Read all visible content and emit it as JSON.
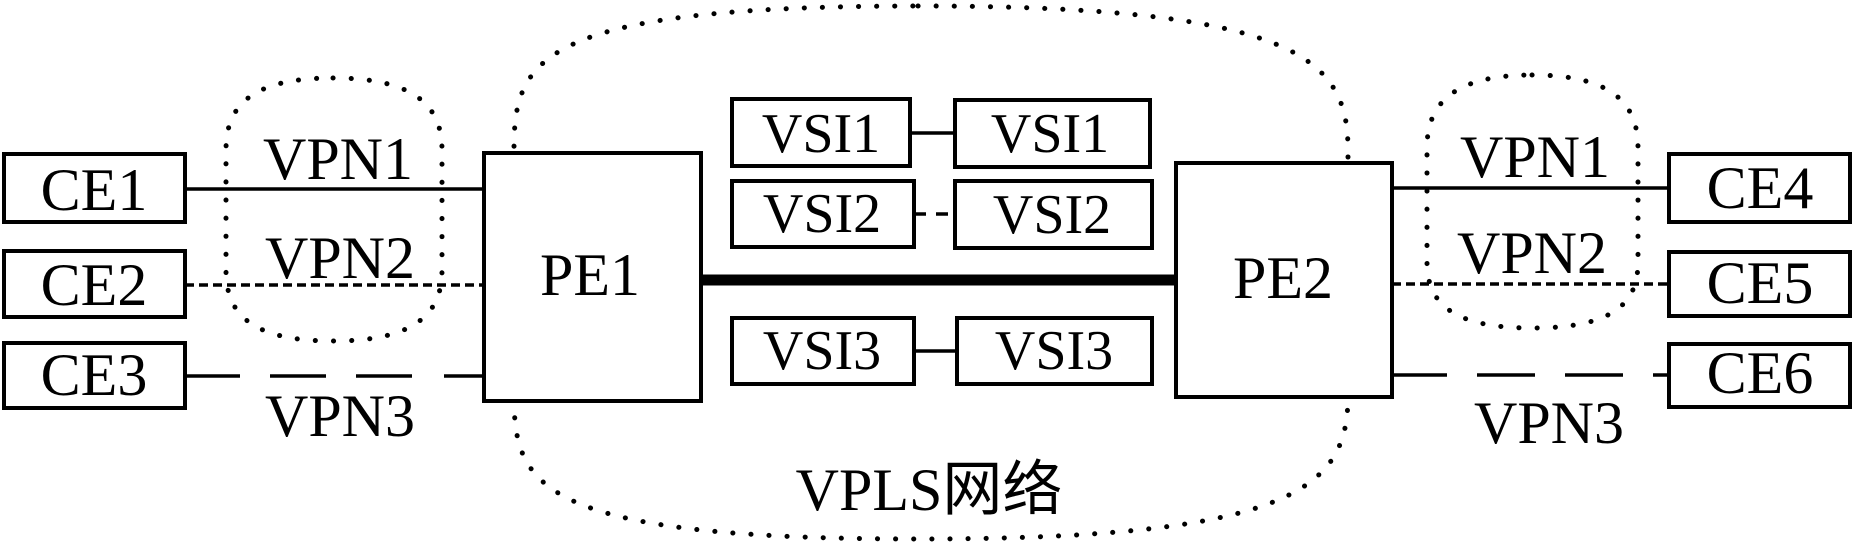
{
  "diagram": {
    "network_label": "VPLS网络",
    "pe_nodes": [
      {
        "id": "pe1",
        "label": "PE1"
      },
      {
        "id": "pe2",
        "label": "PE2"
      }
    ],
    "ce_nodes_left": [
      {
        "id": "ce1",
        "label": "CE1",
        "vpn": "VPN1"
      },
      {
        "id": "ce2",
        "label": "CE2",
        "vpn": "VPN2"
      },
      {
        "id": "ce3",
        "label": "CE3",
        "vpn": "VPN3"
      }
    ],
    "ce_nodes_right": [
      {
        "id": "ce4",
        "label": "CE4",
        "vpn": "VPN1"
      },
      {
        "id": "ce5",
        "label": "CE5",
        "vpn": "VPN2"
      },
      {
        "id": "ce6",
        "label": "CE6",
        "vpn": "VPN3"
      }
    ],
    "vpn_labels_left": [
      "VPN1",
      "VPN2",
      "VPN3"
    ],
    "vpn_labels_right": [
      "VPN1",
      "VPN2",
      "VPN3"
    ],
    "vsi_pairs": [
      {
        "left": "VSI1",
        "right": "VSI1",
        "link": "solid"
      },
      {
        "left": "VSI2",
        "right": "VSI2",
        "link": "dashed"
      },
      {
        "left": "VSI3",
        "right": "VSI3",
        "link": "solid"
      }
    ],
    "link_styles": {
      "VPN1": "solid",
      "VPN2": "dashed",
      "VPN3": "long-dashed",
      "PE1-PE2": "thick-solid"
    }
  }
}
